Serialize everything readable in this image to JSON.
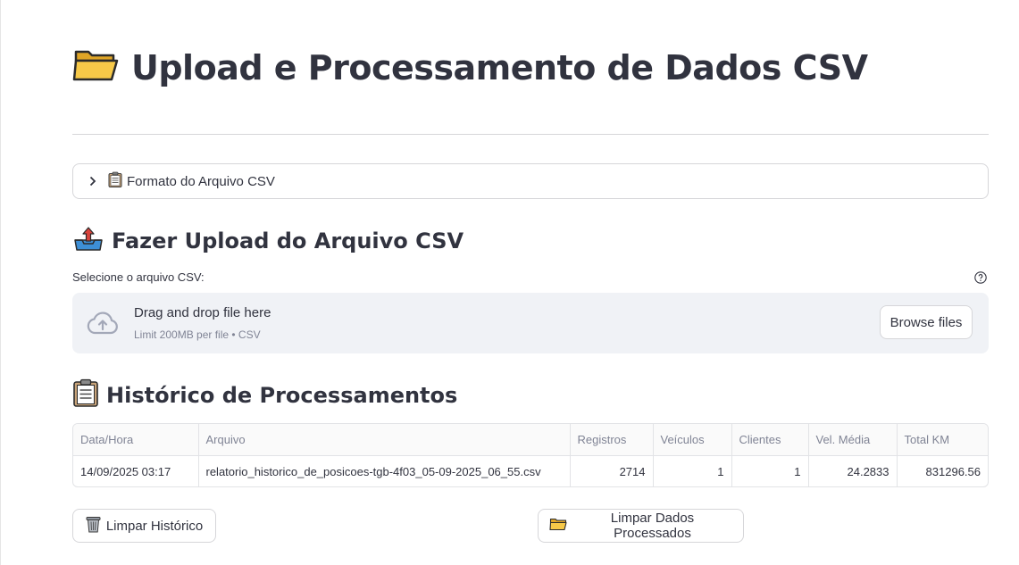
{
  "page": {
    "title": "Upload e Processamento de Dados CSV",
    "title_icon": "folder-icon"
  },
  "expander": {
    "label": "Formato do Arquivo CSV",
    "icon": "clipboard-icon",
    "expanded": false
  },
  "upload_section": {
    "heading": "Fazer Upload do Arquivo CSV",
    "heading_icon": "outbox-tray-icon",
    "uploader_label": "Selecione o arquivo CSV:",
    "drop_text": "Drag and drop file here",
    "limit_text": "Limit 200MB per file • CSV",
    "browse_label": "Browse files"
  },
  "history_section": {
    "heading": "Histórico de Processamentos",
    "heading_icon": "clipboard-icon",
    "columns": [
      "Data/Hora",
      "Arquivo",
      "Registros",
      "Veículos",
      "Clientes",
      "Vel. Média",
      "Total KM"
    ],
    "rows": [
      [
        "14/09/2025 03:17",
        "relatorio_historico_de_posicoes-tgb-4f03_05-09-2025_06_55.csv",
        "2714",
        "1",
        "1",
        "24.2833",
        "831296.56"
      ]
    ]
  },
  "actions": {
    "clear_history_label": "Limpar Histórico",
    "clear_history_icon": "wastebasket-icon",
    "clear_processed_label": "Limpar Dados Processados",
    "clear_processed_icon": "folder-icon"
  },
  "colors": {
    "text": "#31333f",
    "muted": "#808495",
    "dropzone_bg": "#f0f2f6",
    "border": "#d6d6d9",
    "folder": "#f7c948",
    "upload_arrow": "#d9433b"
  }
}
